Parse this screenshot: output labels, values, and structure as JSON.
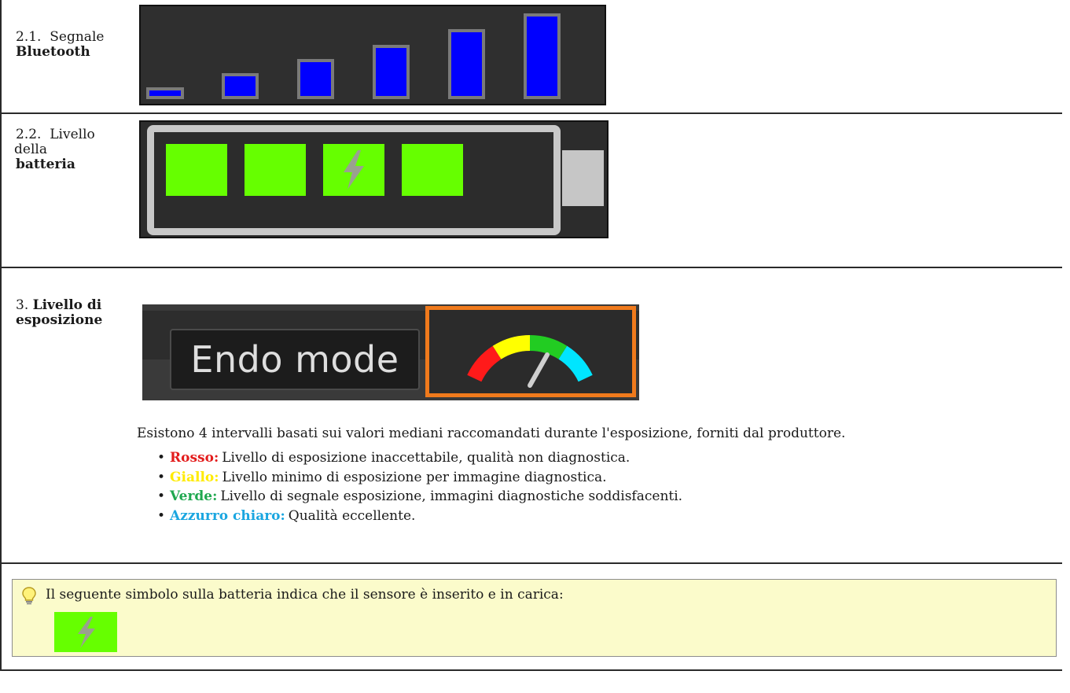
{
  "rows": {
    "bluetooth": {
      "number": "2.1.",
      "label": "Segnale",
      "bold": "Bluetooth",
      "bar_levels": [
        0.12,
        0.27,
        0.41,
        0.56,
        0.72,
        0.88
      ]
    },
    "battery": {
      "number": "2.2.",
      "label_line1": "Livello",
      "label_line2": "della",
      "bold": "batteria",
      "charged_cells": 4,
      "charging": true
    },
    "exposure": {
      "number": "3.",
      "bold_line1": "Livello di",
      "bold_line2": "esposizione",
      "mode_button": "Endo mode",
      "gauge_colors": [
        "#ff1a1a",
        "#ffff00",
        "#22cc22",
        "#00e5ff"
      ],
      "accent": "#f07a1c"
    }
  },
  "exposure_text": {
    "intro": "Esistono 4 intervalli basati sui valori mediani raccomandati durante l'esposizione, forniti dal produttore.",
    "levels": [
      {
        "name": "Rosso:",
        "color": "#e31c1c",
        "desc": "Livello di esposizione inaccettabile, qualità non diagnostica."
      },
      {
        "name": "Giallo:",
        "color": "#ffeb00",
        "desc": "Livello minimo di esposizione per immagine diagnostica."
      },
      {
        "name": "Verde:",
        "color": "#1fa84f",
        "desc": "Livello di segnale esposizione, immagini diagnostiche soddisfacenti."
      },
      {
        "name": "Azzurro chiaro:",
        "color": "#1aa6e0",
        "desc": "Qualità eccellente."
      }
    ]
  },
  "tip": {
    "icon": "lightbulb-icon",
    "text": "Il seguente simbolo sulla batteria indica che il sensore è inserito e in carica:"
  }
}
